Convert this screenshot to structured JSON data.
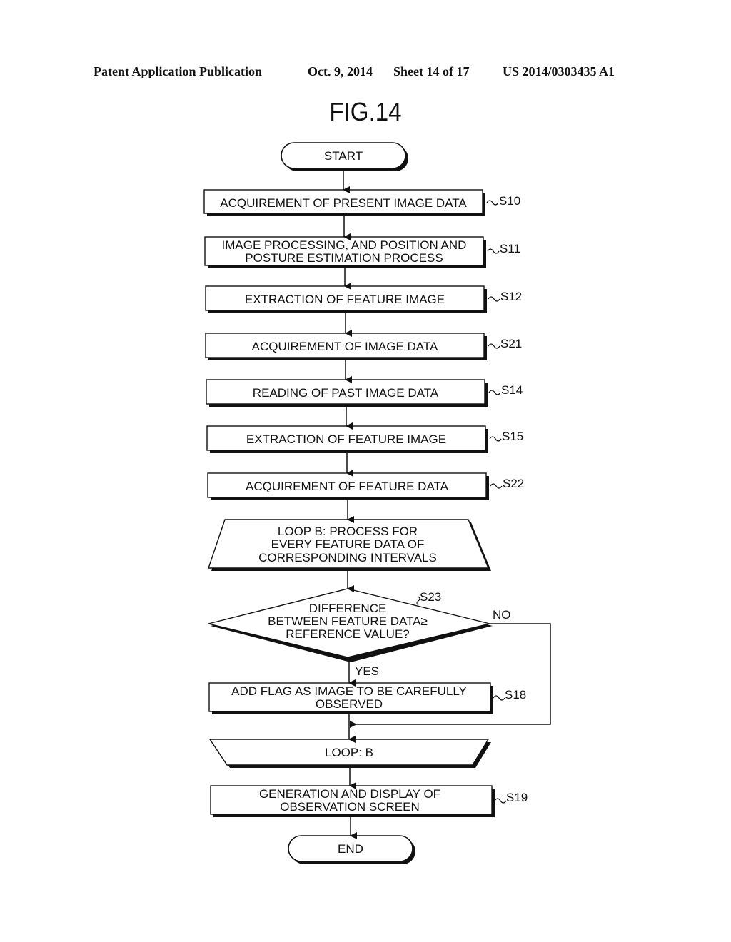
{
  "header": {
    "publication": "Patent Application Publication",
    "date": "Oct. 9, 2014",
    "sheet": "Sheet 14 of 17",
    "number": "US 2014/0303435 A1"
  },
  "figure": {
    "title": "FIG.14"
  },
  "flow": {
    "start": "START",
    "end": "END",
    "steps": [
      {
        "id": "S10",
        "lines": [
          "ACQUIREMENT OF PRESENT IMAGE DATA"
        ]
      },
      {
        "id": "S11",
        "lines": [
          "IMAGE PROCESSING, AND POSITION AND",
          "POSTURE ESTIMATION PROCESS"
        ]
      },
      {
        "id": "S12",
        "lines": [
          "EXTRACTION OF FEATURE IMAGE"
        ]
      },
      {
        "id": "S21",
        "lines": [
          "ACQUIREMENT OF IMAGE DATA"
        ]
      },
      {
        "id": "S14",
        "lines": [
          "READING OF PAST IMAGE DATA"
        ]
      },
      {
        "id": "S15",
        "lines": [
          "EXTRACTION OF FEATURE IMAGE"
        ]
      },
      {
        "id": "S22",
        "lines": [
          "ACQUIREMENT OF FEATURE DATA"
        ]
      }
    ],
    "loop_start": {
      "lines": [
        "LOOP B: PROCESS FOR",
        "EVERY FEATURE DATA OF",
        "CORRESPONDING INTERVALS"
      ]
    },
    "decision": {
      "id": "S23",
      "lines": [
        "DIFFERENCE",
        "BETWEEN FEATURE DATA≥",
        "REFERENCE VALUE?"
      ],
      "yes": "YES",
      "no": "NO"
    },
    "flag_step": {
      "id": "S18",
      "lines": [
        "ADD FLAG AS IMAGE TO BE CAREFULLY",
        "OBSERVED"
      ]
    },
    "loop_end": {
      "lines": [
        "LOOP: B"
      ]
    },
    "final_step": {
      "id": "S19",
      "lines": [
        "GENERATION AND DISPLAY OF",
        "OBSERVATION SCREEN"
      ]
    }
  }
}
